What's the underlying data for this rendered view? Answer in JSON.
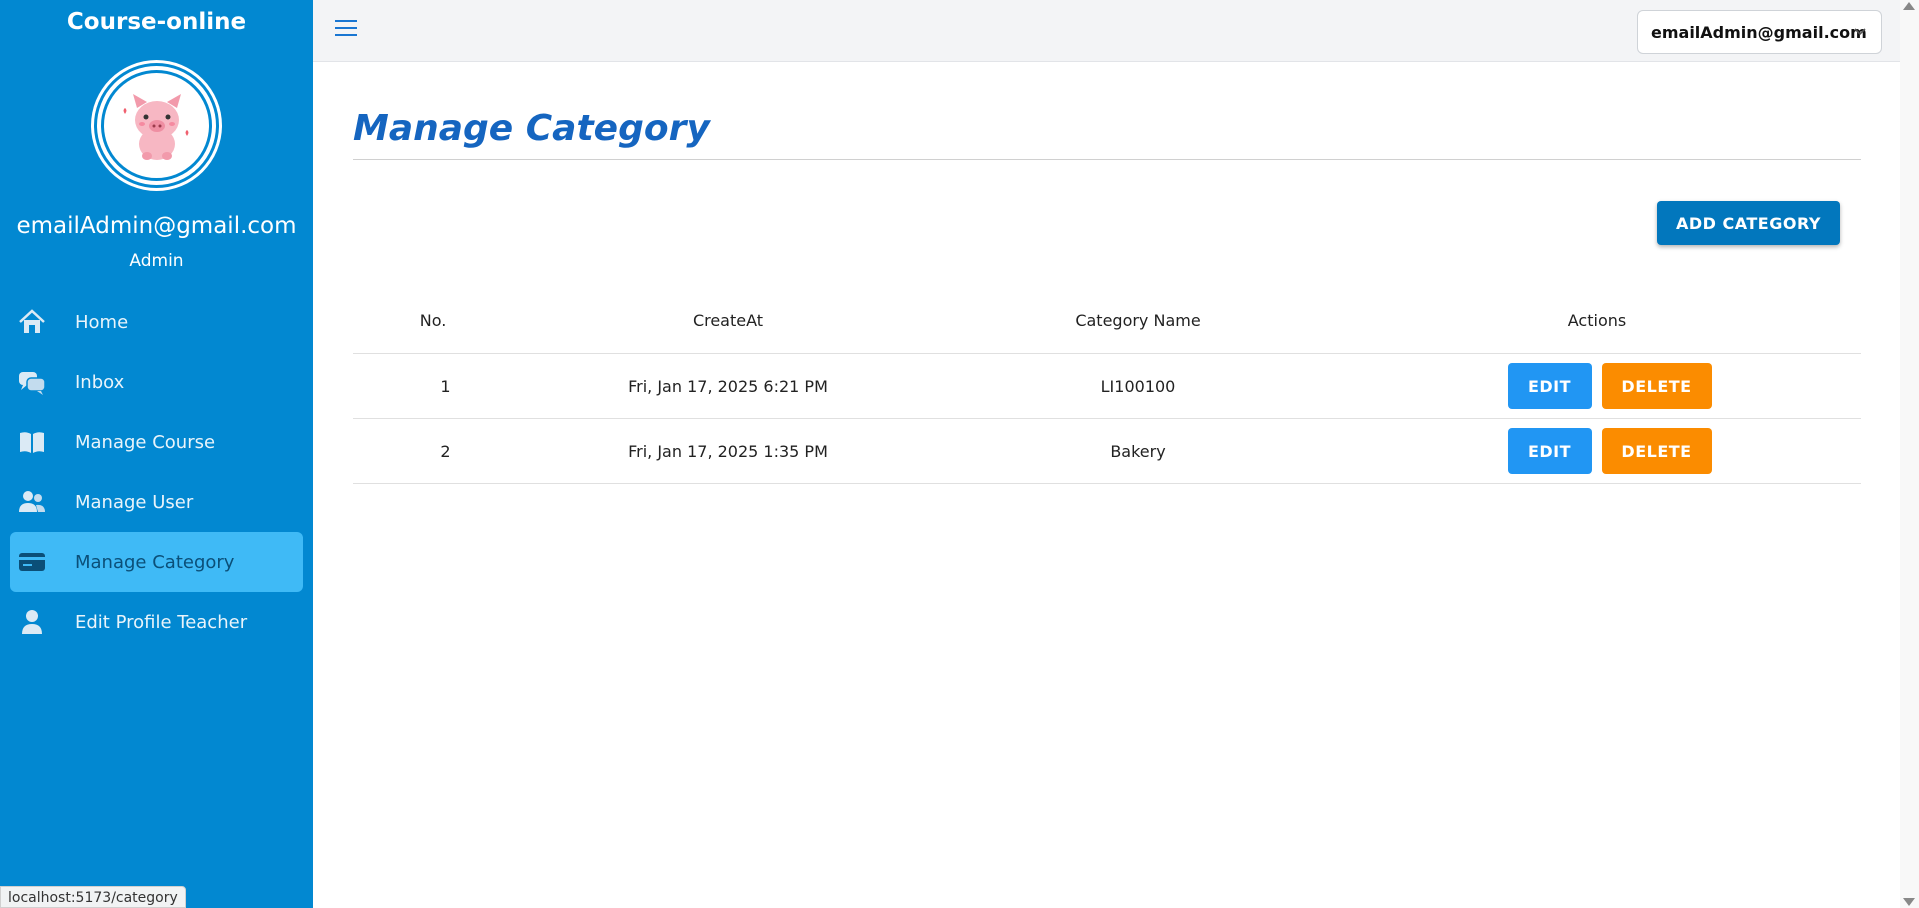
{
  "app": {
    "brand": "Course-online",
    "status_url": "localhost:5173/category"
  },
  "profile": {
    "email": "emailAdmin@gmail.com",
    "role": "Admin",
    "avatar_icon": "pig-avatar"
  },
  "sidebar": {
    "items": [
      {
        "label": "Home",
        "icon": "home-icon"
      },
      {
        "label": "Inbox",
        "icon": "chat-icon"
      },
      {
        "label": "Manage Course",
        "icon": "book-icon"
      },
      {
        "label": "Manage User",
        "icon": "users-icon"
      },
      {
        "label": "Manage Category",
        "icon": "card-icon",
        "active": true
      },
      {
        "label": "Edit Profile Teacher",
        "icon": "person-icon"
      }
    ]
  },
  "topbar": {
    "account_select": "emailAdmin@gmail.com"
  },
  "main": {
    "title": "Manage Category",
    "add_button": "ADD CATEGORY",
    "table": {
      "headers": [
        "No.",
        "CreateAt",
        "Category Name",
        "Actions"
      ],
      "rows": [
        {
          "no": "1",
          "created_at": "Fri, Jan 17, 2025 6:21 PM",
          "name": "LI100100",
          "edit": "EDIT",
          "delete": "DELETE"
        },
        {
          "no": "2",
          "created_at": "Fri, Jan 17, 2025 1:35 PM",
          "name": "Bakery",
          "edit": "EDIT",
          "delete": "DELETE"
        }
      ]
    }
  },
  "colors": {
    "sidebar": "#0288d1",
    "active_item": "#3fbaf6",
    "title": "#1565c0",
    "edit": "#2196f3",
    "delete": "#fb8c00",
    "add": "#0277bd"
  }
}
